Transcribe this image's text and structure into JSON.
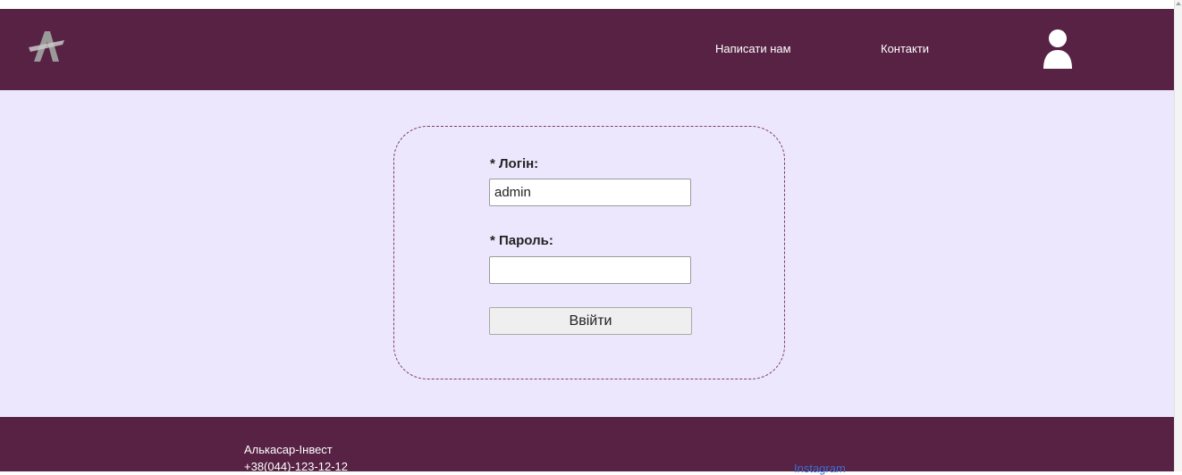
{
  "header": {
    "logo_icon": "stylized-letter-a-icon",
    "nav": {
      "write_us": "Написати нам",
      "contacts": "Контакти"
    },
    "user_icon": "user-profile-icon"
  },
  "login_form": {
    "login_label": "* Логін:",
    "login_value": "admin",
    "password_label": "* Пароль:",
    "password_value": "",
    "submit_label": "Ввійти"
  },
  "footer": {
    "company": "Алькасар-Інвест",
    "phone": "+38(044)-123-12-12",
    "instagram": "Instagram"
  },
  "colors": {
    "brand": "#572244",
    "background": "#ece7fd",
    "link": "#3b6fd4"
  }
}
